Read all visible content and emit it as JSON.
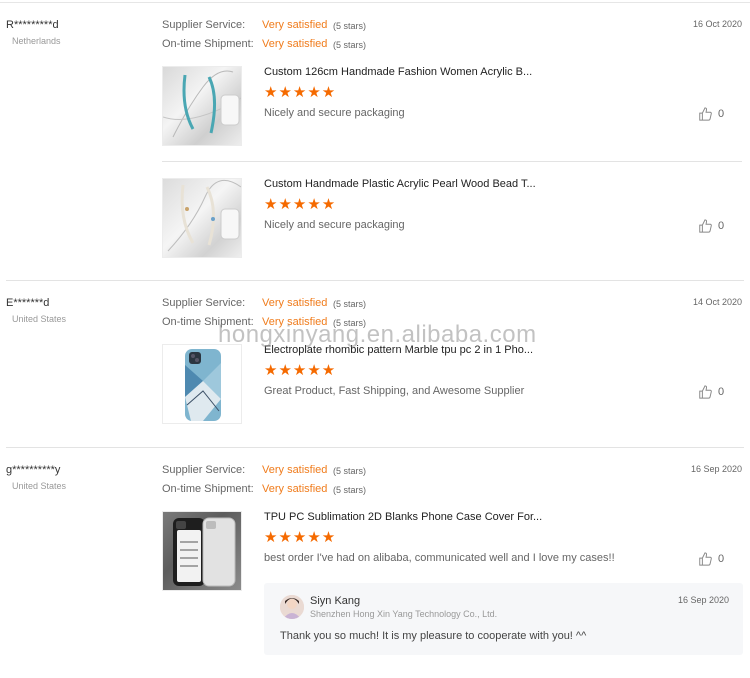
{
  "reviews": [
    {
      "buyer": "R*********d",
      "country": "Netherlands",
      "date": "16 Oct 2020",
      "supplier_service_label": "Supplier Service:",
      "supplier_service_value": "Very satisfied",
      "supplier_service_stars": "(5 stars)",
      "shipment_label": "On-time Shipment:",
      "shipment_value": "Very satisfied",
      "shipment_stars": "(5 stars)",
      "products": [
        {
          "title": "Custom 126cm Handmade Fashion Women Acrylic B...",
          "rating": 5,
          "stars": "★★★★★",
          "comment": "Nicely and secure packaging",
          "likes": "0"
        },
        {
          "title": "Custom Handmade Plastic Acrylic Pearl Wood Bead T...",
          "rating": 5,
          "stars": "★★★★★",
          "comment": "Nicely and secure packaging",
          "likes": "0"
        }
      ]
    },
    {
      "buyer": "E*******d",
      "country": "United States",
      "date": "14 Oct 2020",
      "supplier_service_label": "Supplier Service:",
      "supplier_service_value": "Very satisfied",
      "supplier_service_stars": "(5 stars)",
      "shipment_label": "On-time Shipment:",
      "shipment_value": "Very satisfied",
      "shipment_stars": "(5 stars)",
      "products": [
        {
          "title": "Electroplate rhombic pattern Marble tpu pc 2 in 1 Pho...",
          "rating": 5,
          "stars": "★★★★★",
          "comment": "Great Product, Fast Shipping, and Awesome Supplier",
          "likes": "0"
        }
      ]
    },
    {
      "buyer": "g**********y",
      "country": "United States",
      "date": "16 Sep 2020",
      "supplier_service_label": "Supplier Service:",
      "supplier_service_value": "Very satisfied",
      "supplier_service_stars": "(5 stars)",
      "shipment_label": "On-time Shipment:",
      "shipment_value": "Very satisfied",
      "shipment_stars": "(5 stars)",
      "products": [
        {
          "title": "TPU PC Sublimation 2D Blanks Phone Case Cover For...",
          "rating": 5,
          "stars": "★★★★★",
          "comment": "best order I've had on alibaba, communicated well and I love my cases!!",
          "likes": "0"
        }
      ],
      "reply": {
        "name": "Siyn Kang",
        "company": "Shenzhen Hong Xin Yang Technology Co., Ltd.",
        "date": "16 Sep 2020",
        "text": "Thank you so much! It is my pleasure to cooperate with you! ^^"
      }
    }
  ],
  "watermark": "hongxinyang.en.alibaba.com",
  "icons": {
    "like": "thumbs-up-icon",
    "star": "star-icon"
  },
  "colors": {
    "accent": "#f07c1c",
    "star": "#f56a00"
  }
}
